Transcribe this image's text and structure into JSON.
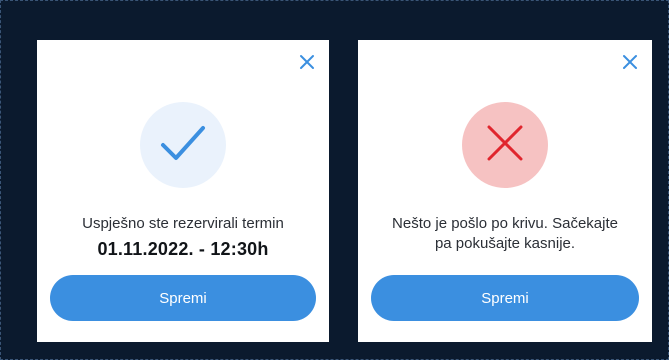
{
  "colors": {
    "background": "#0b1a2e",
    "card": "#ffffff",
    "accent": "#3b8fe0",
    "success_badge_bg": "#eaf2fc",
    "error_badge_bg": "#f6c2c2",
    "error_mark": "#e0262e"
  },
  "success_modal": {
    "close_icon": "close-icon",
    "status_icon": "checkmark-icon",
    "message": "Uspješno ste rezervirali termin",
    "datetime": "01.11.2022. - 12:30h",
    "button_label": "Spremi"
  },
  "error_modal": {
    "close_icon": "close-icon",
    "status_icon": "error-x-icon",
    "message_line1": "Nešto je pošlo po krivu. Sačekajte",
    "message_line2": "pa pokušajte kasnije.",
    "button_label": "Spremi"
  }
}
